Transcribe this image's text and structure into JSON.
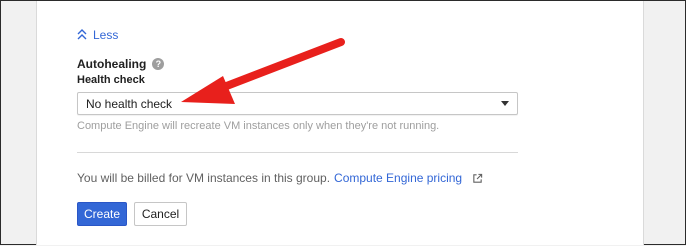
{
  "less_link": {
    "label": "Less",
    "icon": "double-chevron-up-icon"
  },
  "autohealing": {
    "title": "Autohealing",
    "help_icon": "help-icon",
    "health_check_label": "Health check",
    "health_check_value": "No health check",
    "hint": "Compute Engine will recreate VM instances only when they're not running."
  },
  "billing": {
    "text": "You will be billed for VM instances in this group.",
    "link_label": "Compute Engine pricing",
    "link_icon": "external-link-icon"
  },
  "actions": {
    "create_label": "Create",
    "cancel_label": "Cancel"
  },
  "colors": {
    "accent": "#3367d6",
    "annotation_arrow": "#e8201c"
  }
}
